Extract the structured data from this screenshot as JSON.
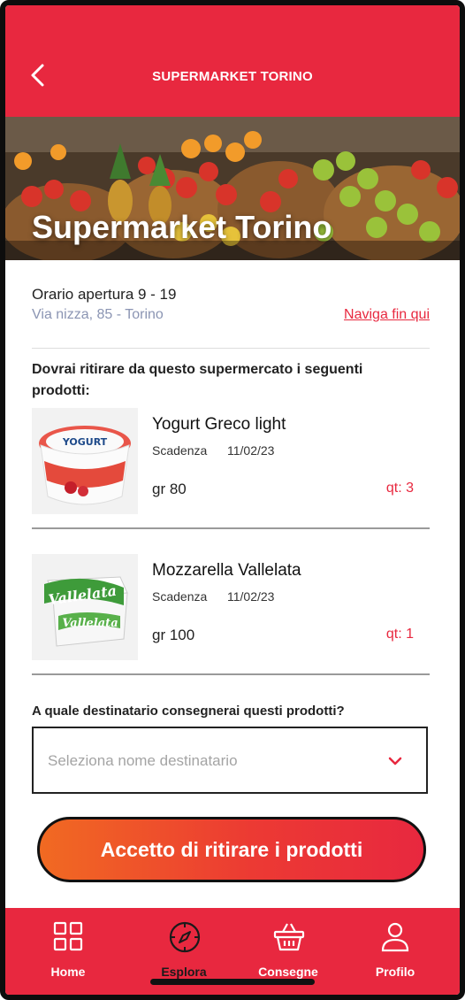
{
  "header": {
    "title": "SUPERMARKET TORINO",
    "back_icon": "chevron-left-icon"
  },
  "hero": {
    "title": "Supermarket Torino"
  },
  "store": {
    "hours": "Orario apertura 9 - 19",
    "address": "Via nizza, 85 - Torino",
    "navigate_link": "Naviga fin qui"
  },
  "pickup": {
    "intro": "Dovrai ritirare da questo supermercato i seguenti prodotti:",
    "products": [
      {
        "name": "Yogurt Greco light",
        "expiry_label": "Scadenza",
        "expiry_date": "11/02/23",
        "weight": "gr 80",
        "quantity": "qt: 3",
        "image_text": "YOGURT"
      },
      {
        "name": "Mozzarella Vallelata",
        "expiry_label": "Scadenza",
        "expiry_date": "11/02/23",
        "weight": "gr 100",
        "quantity": "qt: 1",
        "image_text": "Vallelata"
      }
    ]
  },
  "recipient": {
    "question": "A quale destinatario consegnerai questi prodotti?",
    "placeholder": "Seleziona nome destinatario",
    "chevron_icon": "chevron-down-icon"
  },
  "cta": {
    "label": "Accetto di ritirare i prodotti"
  },
  "tabbar": {
    "active": "Esplora",
    "items": [
      {
        "label": "Home",
        "icon": "grid-icon"
      },
      {
        "label": "Esplora",
        "icon": "compass-icon"
      },
      {
        "label": "Consegne",
        "icon": "basket-icon"
      },
      {
        "label": "Profilo",
        "icon": "user-icon"
      }
    ]
  },
  "colors": {
    "brand_red": "#e8283f",
    "cta_orange": "#f16a22",
    "address_gray": "#8b95b3"
  }
}
